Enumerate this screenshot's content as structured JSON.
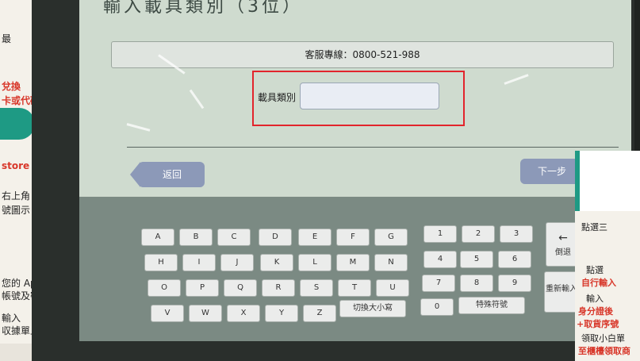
{
  "poster_left": {
    "lines": [
      "最",
      "兌換",
      "卡或代碼",
      "store",
      "右上角",
      "號圖示",
      "您的 Apple ID",
      "帳號及密碼",
      "輸入",
      "収據單上的密碼"
    ]
  },
  "poster_right": {
    "lines": [
      "點選三",
      "點選",
      "自行輸入",
      "輸入",
      "身分證後",
      "+取貨序號",
      "領取小白單",
      "至櫃檯領取商"
    ]
  },
  "screen": {
    "title": "輸入載具類別（3位）",
    "service_text": "客服專線：0800-521-988",
    "field_label": "載具類別",
    "field_value": "",
    "back_label": "返回",
    "next_label": "下一步",
    "letter_rows": [
      [
        "A",
        "B",
        "C",
        "D",
        "E",
        "F",
        "G"
      ],
      [
        "H",
        "I",
        "J",
        "K",
        "L",
        "M",
        "N"
      ],
      [
        "O",
        "P",
        "Q",
        "R",
        "S",
        "T",
        "U"
      ],
      [
        "V",
        "W",
        "X",
        "Y",
        "Z"
      ]
    ],
    "toggle_case_label": "切換大小寫",
    "digit_rows": [
      [
        "1",
        "2",
        "3"
      ],
      [
        "4",
        "5",
        "6"
      ],
      [
        "7",
        "8",
        "9"
      ],
      [
        "0"
      ]
    ],
    "special_label": "特殊符號",
    "backspace_label": "倒退",
    "reenter_label": "重新輸入"
  },
  "colors": {
    "highlight": "#e2242c",
    "nav_button": "#8c99b8",
    "screen_bg": "#cfdbcf",
    "keyboard_bg": "#7b8a83"
  }
}
